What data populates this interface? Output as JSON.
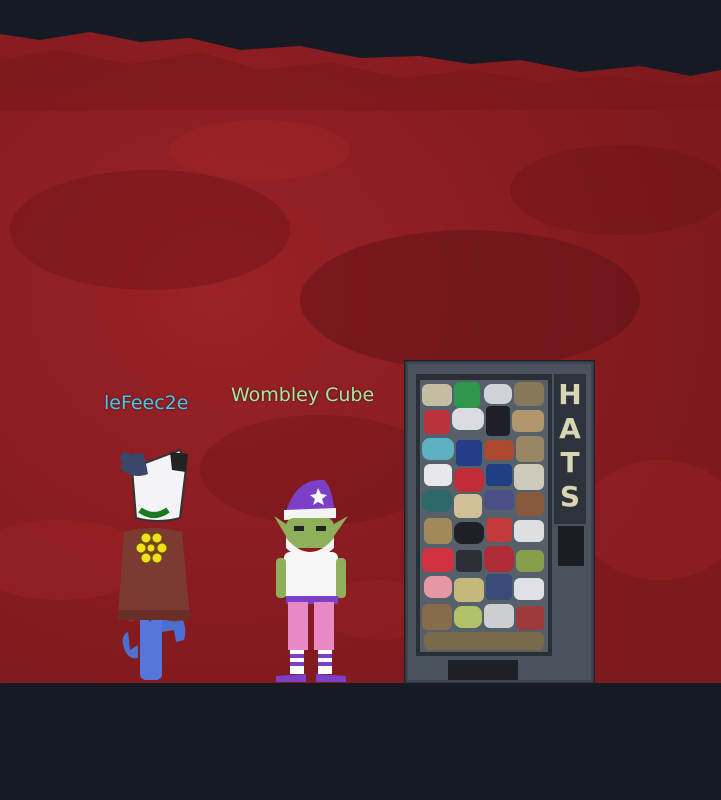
{
  "players": [
    {
      "name": "leFeec2e",
      "color": "#44c8ec",
      "avatar_icon": "marshmallow-poncho-character-icon"
    },
    {
      "name": "Wombley Cube",
      "color": "#a6e6a2",
      "avatar_icon": "elf-purple-hat-character-icon"
    }
  ],
  "vending_machine": {
    "sign": "HATS",
    "icon": "hat-vending-machine-icon"
  },
  "colors": {
    "wall": "#8c1c20",
    "wall_dark": "#6a1216",
    "floor": "#161a23",
    "machine_body": "#3d4450",
    "sign_text": "#d8d6b2"
  }
}
